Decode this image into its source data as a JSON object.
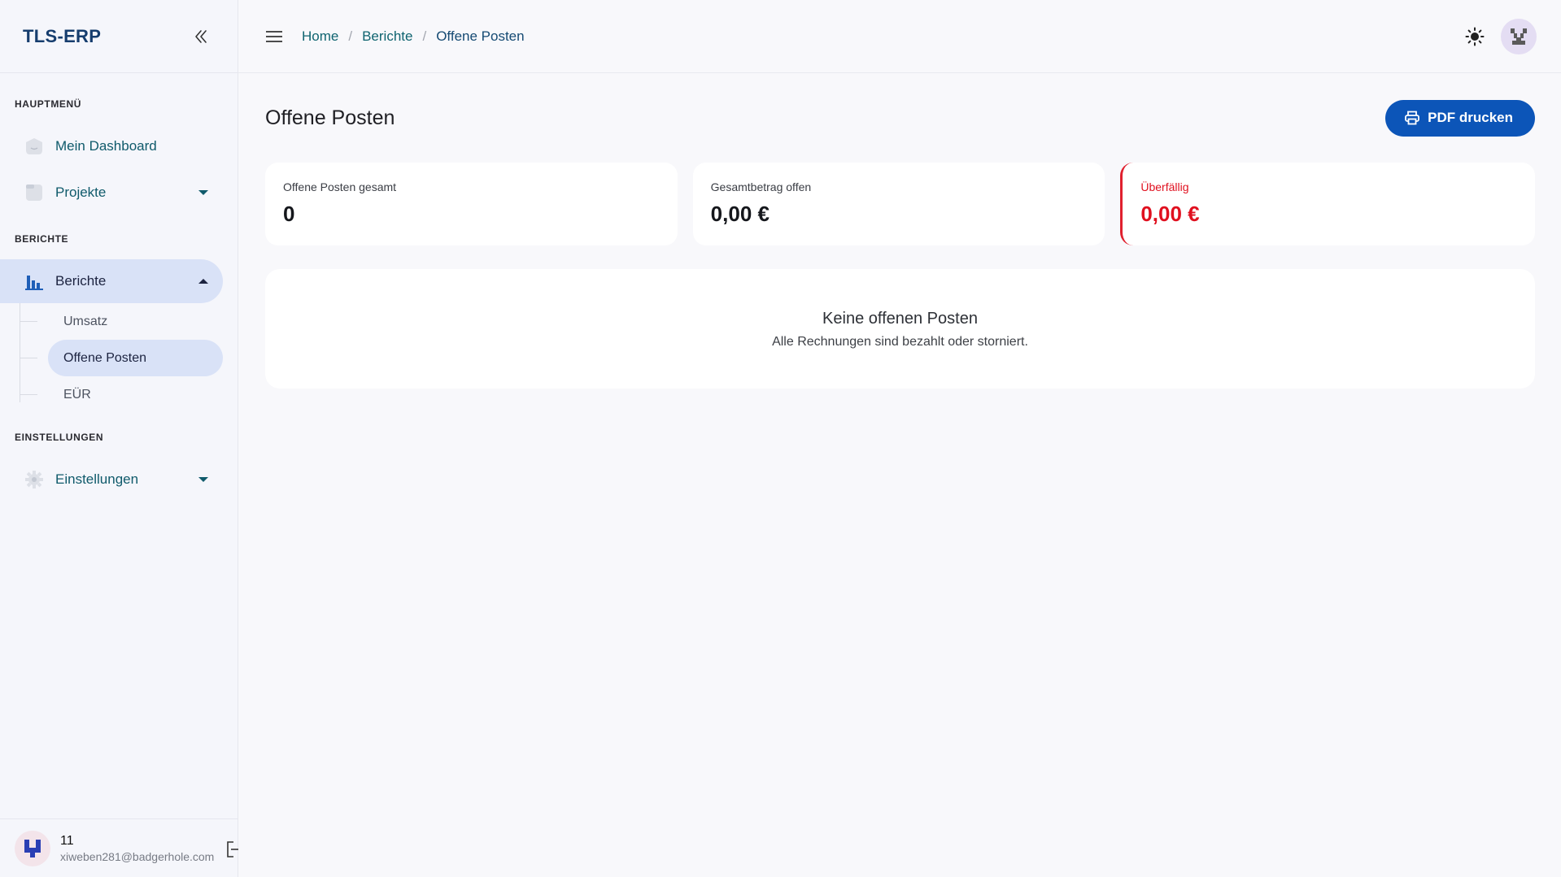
{
  "brand": "TLS-ERP",
  "sidebar": {
    "sections": {
      "main": "HAUPTMENÜ",
      "reports": "BERICHTE",
      "settings": "EINSTELLUNGEN"
    },
    "items": {
      "dashboard": "Mein Dashboard",
      "projects": "Projekte",
      "reports": "Berichte",
      "settings": "Einstellungen"
    },
    "report_subitems": [
      "Umsatz",
      "Offene Posten",
      "EÜR"
    ]
  },
  "user": {
    "name": "11",
    "email": "xiweben281@badgerhole.com"
  },
  "breadcrumb": [
    "Home",
    "Berichte",
    "Offene Posten"
  ],
  "page": {
    "title": "Offene Posten",
    "pdf_button": "PDF drucken"
  },
  "cards": [
    {
      "label": "Offene Posten gesamt",
      "value": "0"
    },
    {
      "label": "Gesamtbetrag offen",
      "value": "0,00 €"
    },
    {
      "label": "Überfällig",
      "value": "0,00 €"
    }
  ],
  "empty_state": {
    "title": "Keine offenen Posten",
    "subtitle": "Alle Rechnungen sind bezahlt oder storniert."
  },
  "colors": {
    "brand": "#163d6e",
    "primary_button": "#0c55b8",
    "active_nav": "#d9e2f7",
    "overdue": "#e0101f"
  }
}
